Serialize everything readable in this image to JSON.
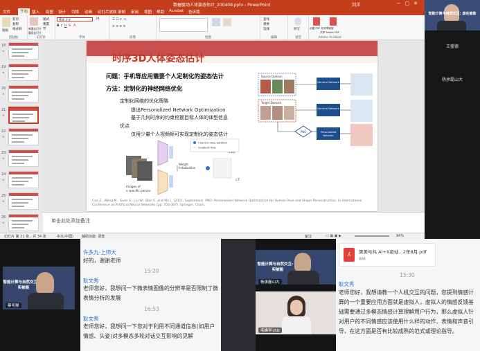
{
  "ppt": {
    "window_title": "数据驱动人体姿态估计_200408.pptx - PowerPoint",
    "user_name": "刘洋",
    "user_badge": "刘",
    "menu": [
      "文件",
      "开始",
      "插入",
      "绘图",
      "设计",
      "切换",
      "动画",
      "幻灯片放映",
      "录制",
      "审阅",
      "视图",
      "帮助",
      "Acrobat",
      "告诉我"
    ],
    "active_menu": "开始",
    "ribbon": {
      "clipboard": {
        "paste": "粘贴",
        "cut": "剪切",
        "copy": "复制",
        "format_painter": "格式刷",
        "label": "剪贴板"
      },
      "slides": {
        "new_slide": "新建幻灯片",
        "reuse": "重用幻灯片",
        "layout": "版式",
        "reset": "重置",
        "section": "节",
        "label": "幻灯片"
      },
      "font": {
        "font_name_value": "等线 正文",
        "font_size": "24",
        "label": "字体"
      },
      "paragraph": {
        "label": "段落"
      },
      "drawing": {
        "label": "绘图"
      },
      "editing": {
        "find": "查找",
        "replace": "替换",
        "select": "选择",
        "label": "编辑"
      },
      "voice": {
        "dictate": "听写",
        "label": "语音"
      },
      "acrobat": {
        "create_share": "创建 PDF 并共享链接",
        "share_pdf": "共享 Adobe PDF",
        "label": "Adobe Acrobat"
      }
    },
    "thumbnails": [
      {
        "num": "18"
      },
      {
        "num": "19"
      },
      {
        "num": "20"
      },
      {
        "num": "21"
      },
      {
        "num": "22"
      },
      {
        "num": "23"
      },
      {
        "num": "24"
      },
      {
        "num": "25"
      },
      {
        "num": "26"
      }
    ],
    "selected_slide": "21",
    "notes_placeholder": "单击此处添加备注",
    "status": {
      "slide_info": "幻灯片 第 21 张，共 34 张",
      "language": "中文(中国)",
      "accessibility": "辅助功能: 调查",
      "notes": "备注",
      "zoom": "94%"
    }
  },
  "slide": {
    "title": "时序3D人体姿态估计",
    "question": "问题：手机等应用需要个人定制化的姿态估计",
    "method": "方法：定制化的神经网络优化",
    "bullets": [
      "定制化网络的优化策略",
      "提出Personalized Network Optimization",
      "基于几何时序的约束挖掘目标人体的体型信息",
      "优点",
      "仅用少量个人视频帧可实现定制化的姿态估计"
    ],
    "diagram": {
      "source_domain": "Source Domain",
      "target_domain": "Target Domain",
      "general_network": "General Network",
      "pno": "PNO",
      "personalized_network": "Personalized Network",
      "legend_channel": "Channel-wise addition",
      "legend_gradient": "Gradient flow",
      "weight_init": "Weight Initialization",
      "images_caption": "Images of a specific person",
      "l2d": "ℒ2D",
      "lt": "ℒT"
    },
    "citation": "Cao Z., Wang M., Guan S., Liu W., Qian C. and Ma L. (2021, September). PNO: Personalized Network Optimization for Human Pose and Shape Reconstruction. In International Conference on Artificial Neural Networks (pp. 356-367). Springer, Cham."
  },
  "video_top_right": {
    "banner": "智能计算与自然交互: 虚实被能",
    "name1": "王盛德",
    "name2": "杨承磊山大"
  },
  "video_bottom_left": {
    "banner": "智能计算与自然交互: 虚实被能",
    "name": "蔡毛猴"
  },
  "chat_left": [
    {
      "name": "许多九-上师大",
      "msg": "好的，谢谢老师",
      "time": "15:20"
    },
    {
      "name": "耿文秀",
      "msg": "老师您好，我想问一下微表情图像的分辨率是否限制了微表情分析的发展",
      "time": "16:53"
    },
    {
      "name": "耿文秀",
      "msg": "老师您好，我想问一下您对于利用不同通道信息(如用户情感、头姿)对多模态多轮对话交互影响的见解"
    }
  ],
  "video_bottom_mid": {
    "banner": "智能计算与自然交互: 虚实被能",
    "name1": "杨承磊山大",
    "name2": "毛峰学-JSU"
  },
  "chat_right": {
    "file": {
      "name": "美美与共 AI+X驱动…2年8月.pdf",
      "size": "8M"
    },
    "time": "15:30",
    "name": "耿文秀",
    "msg": "老师您好，我想请教一个人机交互的问题，您提到情感计算的一个重要应用方面就是虚拟人，虚拟人的情感反馈基础需要通过多模态情感计算理解用户行为，那么虚拟人针对用户的不同情感应该使用什么样的动作、表情和声音引导，在这方面是否有比较成熟的范式或理论指导。"
  },
  "colors": {
    "ppt_accent": "#c43e1c",
    "slide_title": "#c0392b",
    "chat_name": "#2f6fd6",
    "network_box": "#1f4e8c"
  }
}
